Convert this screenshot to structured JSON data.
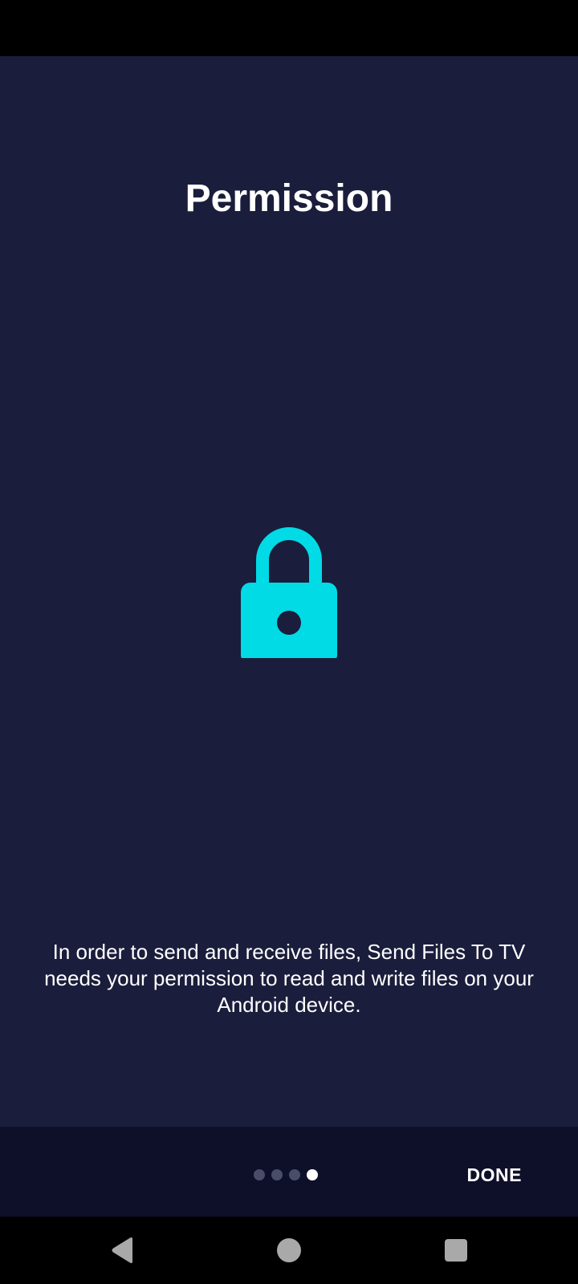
{
  "onboarding": {
    "title": "Permission",
    "description": "In order to send and receive files, Send Files To TV needs your permission to read and write files on your Android device.",
    "icon": "lock-icon",
    "accent_color": "#00dbe6",
    "background_color": "#1a1d3b"
  },
  "pager": {
    "total_pages": 4,
    "current_page": 4
  },
  "bottom_bar": {
    "done_label": "DONE"
  },
  "nav_bar": {
    "back_icon": "back-triangle-icon",
    "home_icon": "home-circle-icon",
    "recents_icon": "recents-square-icon"
  }
}
